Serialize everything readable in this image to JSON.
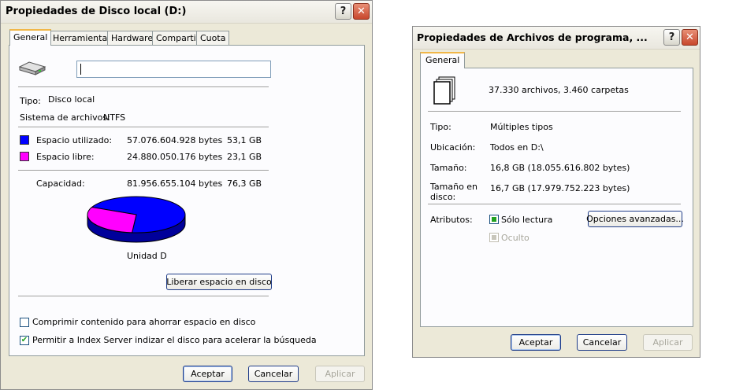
{
  "left": {
    "title": "Propiedades de Disco local (D:)",
    "help_glyph": "?",
    "close_glyph": "✕",
    "tabs": [
      "General",
      "Herramientas",
      "Hardware",
      "Compartir",
      "Cuota"
    ],
    "drive_icon": "hard-drive-icon",
    "type_label": "Tipo:",
    "type_value": "Disco local",
    "fs_label": "Sistema de archivos:",
    "fs_value": "NTFS",
    "used_label": "Espacio utilizado:",
    "used_bytes": "57.076.604.928 bytes",
    "used_gb": "53,1 GB",
    "free_label": "Espacio libre:",
    "free_bytes": "24.880.050.176 bytes",
    "free_gb": "23,1 GB",
    "capacity_label": "Capacidad:",
    "capacity_bytes": "81.956.655.104 bytes",
    "capacity_gb": "76,3 GB",
    "pie_label": "Unidad D",
    "used_fraction": 0.696,
    "used_color": "#0000ff",
    "free_color": "#ff00ff",
    "cleanup_button": "Liberar espacio en disco",
    "compress_label": "Comprimir contenido para ahorrar espacio en disco",
    "compress_checked": false,
    "index_label": "Permitir a Index Server indizar el disco para acelerar la búsqueda",
    "index_checked": true,
    "check_glyph": "✔",
    "ok_button": "Aceptar",
    "cancel_button": "Cancelar",
    "apply_button": "Aplicar"
  },
  "right": {
    "title": "Propiedades de Archivos de programa, ...",
    "help_glyph": "?",
    "close_glyph": "✕",
    "tab_general": "General",
    "files_icon": "multiple-files-icon",
    "summary": "37.330 archivos, 3.460 carpetas",
    "type_label": "Tipo:",
    "type_value": "Múltiples tipos",
    "location_label": "Ubicación:",
    "location_value": "Todos en D:\\",
    "size_label": "Tamaño:",
    "size_value": "16,8 GB (18.055.616.802 bytes)",
    "disk_size_label_line1": "Tamaño en",
    "disk_size_label_line2": "disco:",
    "disk_size_value": "16,7 GB (17.979.752.223 bytes)",
    "attributes_label": "Atributos:",
    "readonly_label": "Sólo lectura",
    "readonly_state": "mixed",
    "hidden_label": "Oculto",
    "hidden_state": "mixed-disabled",
    "advanced_button": "Opciones avanzadas...",
    "ok_button": "Aceptar",
    "cancel_button": "Cancelar",
    "apply_button": "Aplicar"
  }
}
